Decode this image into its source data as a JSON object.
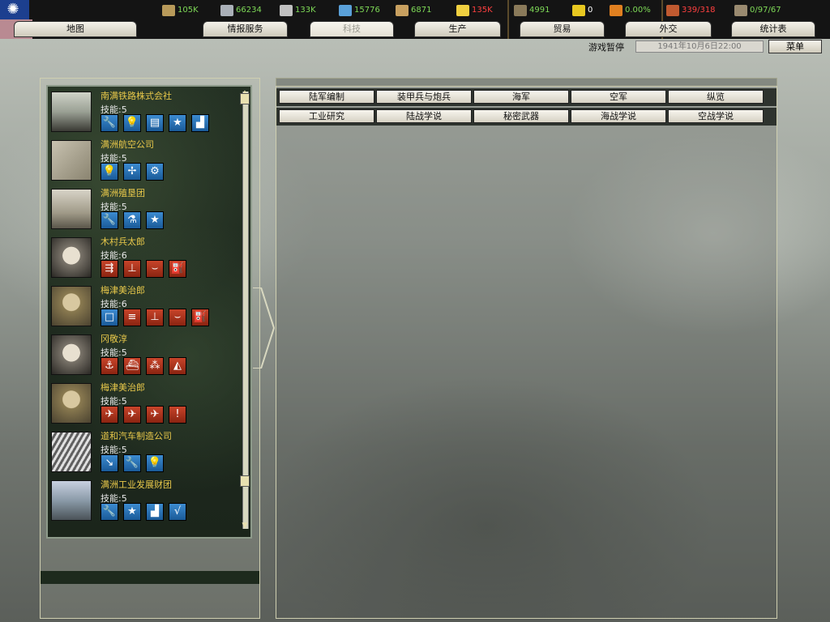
{
  "resources": [
    {
      "name": "energy",
      "icon": "coal-icon",
      "value": "105K",
      "color": "#7ed957"
    },
    {
      "name": "metal",
      "icon": "metal-icon",
      "value": "66234",
      "color": "#7ed957"
    },
    {
      "name": "rare-materials",
      "icon": "rare-materials-icon",
      "value": "133K",
      "color": "#7ed957"
    },
    {
      "name": "oil",
      "icon": "oil-drop-icon",
      "value": "15776",
      "color": "#7ed957"
    },
    {
      "name": "supplies",
      "icon": "supplies-crate-icon",
      "value": "6871",
      "color": "#7ed957"
    },
    {
      "name": "money",
      "icon": "dollar-icon",
      "value": "135K",
      "color": "#ff4040"
    }
  ],
  "stats": [
    {
      "name": "manpower",
      "icon": "soldiers-icon",
      "value": "4991",
      "color": "#7ed957"
    },
    {
      "name": "nuclear",
      "icon": "radiation-icon",
      "value": "0",
      "color": "#ffffff"
    },
    {
      "name": "dissent",
      "icon": "fist-icon",
      "value": "0.00%",
      "color": "#7ed957"
    },
    {
      "name": "transport",
      "icon": "convoy-icon",
      "value": "339/318",
      "color": "#ff4040"
    },
    {
      "name": "divisions",
      "icon": "troops-icon",
      "value": "0/97/67",
      "color": "#7ed957"
    }
  ],
  "tabs": [
    "地图",
    "情报服务",
    "科技",
    "生产",
    "贸易",
    "外交",
    "统计表"
  ],
  "status": {
    "paused_label": "游戏暂停",
    "date": "1941年10月6日22:00",
    "menu_label": "菜单"
  },
  "categories_row1": [
    "陆军编制",
    "装甲兵与炮兵",
    "海军",
    "空军",
    "纵览"
  ],
  "categories_row2": [
    "工业研究",
    "陆战学说",
    "秘密武器",
    "海战学说",
    "空战学说"
  ],
  "teams": [
    {
      "name": "南满铁路株式会社",
      "skill": "技能:5",
      "photo": "train-photo",
      "icons": [
        [
          "wrench-icon",
          "blue"
        ],
        [
          "lightbulb-icon",
          "blue"
        ],
        [
          "document-gear-icon",
          "blue"
        ],
        [
          "star-icon",
          "blue"
        ],
        [
          "factory-icon",
          "blue"
        ]
      ]
    },
    {
      "name": "满洲航空公司",
      "skill": "技能:5",
      "photo": "airplane-photo",
      "icons": [
        [
          "lightbulb-icon",
          "blue"
        ],
        [
          "propeller-icon",
          "blue"
        ],
        [
          "gears-icon",
          "blue"
        ]
      ]
    },
    {
      "name": "满洲殖垦团",
      "skill": "技能:5",
      "photo": "building-photo",
      "icons": [
        [
          "wrench-icon",
          "blue"
        ],
        [
          "flask-icon",
          "blue"
        ],
        [
          "star-icon",
          "blue"
        ]
      ]
    },
    {
      "name": "木村兵太郎",
      "skill": "技能:6",
      "photo": "portrait-photo",
      "icons": [
        [
          "split-arrow-icon",
          "red"
        ],
        [
          "org-chart-icon",
          "red"
        ],
        [
          "wing-icon",
          "red"
        ],
        [
          "fuel-icon",
          "red"
        ]
      ]
    },
    {
      "name": "梅津美治郎",
      "skill": "技能:6",
      "photo": "officer-photo",
      "icons": [
        [
          "square-icon",
          "blue"
        ],
        [
          "formation-icon",
          "red"
        ],
        [
          "org-chart-icon",
          "red"
        ],
        [
          "wing-icon",
          "red"
        ],
        [
          "fuel-icon",
          "red"
        ]
      ]
    },
    {
      "name": "冈敬淳",
      "skill": "技能:5",
      "photo": "portrait-photo",
      "icons": [
        [
          "anchor-icon",
          "red"
        ],
        [
          "ship-icon",
          "red"
        ],
        [
          "naval-formation-icon",
          "red"
        ],
        [
          "sextant-icon",
          "red"
        ]
      ]
    },
    {
      "name": "梅津美治郎",
      "skill": "技能:5",
      "photo": "officer-photo",
      "icons": [
        [
          "fighter-plane-icon",
          "red"
        ],
        [
          "bomber-icon",
          "red"
        ],
        [
          "heavy-bomber-icon",
          "red"
        ],
        [
          "missile-icon",
          "red"
        ]
      ]
    },
    {
      "name": "道和汽车制造公司",
      "skill": "技能:5",
      "photo": "factory-photo",
      "icons": [
        [
          "screwdriver-icon",
          "blue"
        ],
        [
          "wrench-icon",
          "blue"
        ],
        [
          "lightbulb-icon",
          "blue"
        ]
      ]
    },
    {
      "name": "满洲工业发展财团",
      "skill": "技能:5",
      "photo": "industry-photo",
      "icons": [
        [
          "wrench-icon",
          "blue"
        ],
        [
          "star-icon",
          "blue"
        ],
        [
          "factory-icon",
          "blue"
        ],
        [
          "sqrt-icon",
          "blue"
        ]
      ]
    }
  ]
}
